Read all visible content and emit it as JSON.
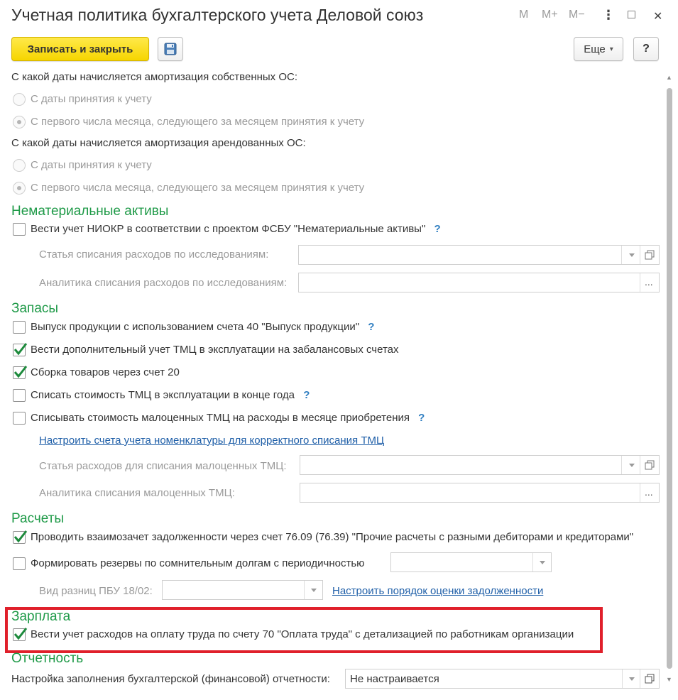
{
  "window": {
    "title": "Учетная политика бухгалтерского учета Деловой союз",
    "buttons": {
      "m": "M",
      "mplus": "M+",
      "mminus": "M−",
      "menu": "⋮",
      "maximize": "□",
      "close": "✕"
    }
  },
  "toolbar": {
    "save_close_label": "Записать и закрыть",
    "more_label": "Еще",
    "more_arrow": "▾",
    "help_label": "?"
  },
  "fixed_assets": {
    "own_question": "С какой даты начисляется амортизация собственных ОС:",
    "own_options": [
      "С даты принятия к учету",
      "С первого числа месяца, следующего за месяцем принятия к учету"
    ],
    "own_selected": 1,
    "leased_question": "С какой даты начисляется амортизация арендованных ОС:",
    "leased_options": [
      "С даты принятия к учету",
      "С первого числа месяца, следующего за месяцем принятия к учету"
    ],
    "leased_selected": 1
  },
  "intangibles": {
    "heading": "Нематериальные активы",
    "niokr_label": "Вести учет НИОКР в соответствии с проектом ФСБУ \"Нематериальные активы\"",
    "niokr_checked": false,
    "research_item_label": "Статья списания расходов по исследованиям:",
    "research_analytics_label": "Аналитика списания расходов по исследованиям:"
  },
  "inventory": {
    "heading": "Запасы",
    "items": [
      {
        "label": "Выпуск продукции с использованием счета 40 \"Выпуск продукции\"",
        "checked": false,
        "help": true
      },
      {
        "label": "Вести дополнительный учет ТМЦ в эксплуатации на забалансовых счетах",
        "checked": true,
        "help": false
      },
      {
        "label": "Сборка товаров через счет 20",
        "checked": true,
        "help": false
      },
      {
        "label": "Списать стоимость ТМЦ в эксплуатации в конце года",
        "checked": false,
        "help": true
      },
      {
        "label": "Списывать стоимость малоценных ТМЦ на расходы в месяце приобретения",
        "checked": false,
        "help": true
      }
    ],
    "setup_link": "Настроить счета учета номенклатуры для корректного списания ТМЦ",
    "expense_item_label": "Статья расходов для списания малоценных ТМЦ:",
    "expense_analytics_label": "Аналитика списания малоценных ТМЦ:"
  },
  "settlements": {
    "heading": "Расчеты",
    "netting_label": "Проводить взаимозачет задолженности через счет 76.09 (76.39) \"Прочие расчеты с разными дебиторами и кредиторами\"",
    "netting_checked": true,
    "reserves_label": "Формировать резервы по сомнительным долгам с периодичностью",
    "reserves_checked": false,
    "pbu_label": "Вид разниц ПБУ 18/02:",
    "assessment_link": "Настроить порядок оценки задолженности"
  },
  "salary": {
    "heading": "Зарплата",
    "label": "Вести учет расходов на оплату труда по счету 70 \"Оплата труда\" с детализацией по работникам организации",
    "checked": true
  },
  "reporting": {
    "heading": "Отчетность",
    "label": "Настройка заполнения бухгалтерской (финансовой)  отчетности:",
    "value": "Не настраивается"
  },
  "colors": {
    "section_heading": "#1f9a48",
    "primary_button": "#f6d500",
    "highlight_frame": "#e0202b",
    "link": "#1f5fa8",
    "help": "#2f7ec1"
  }
}
